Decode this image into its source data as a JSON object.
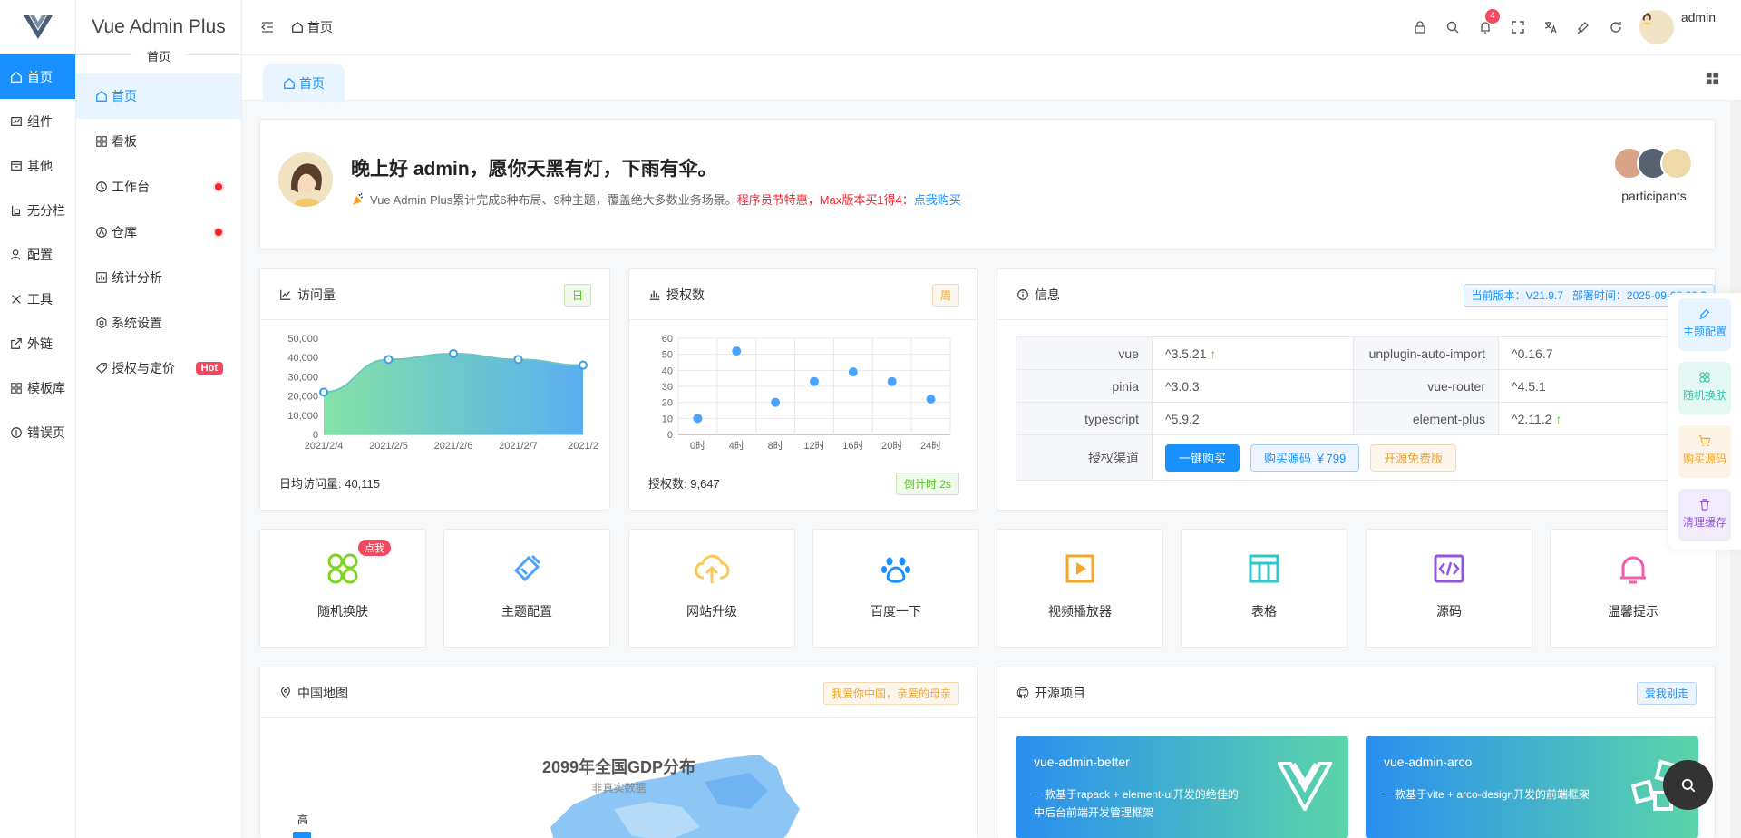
{
  "rail": {
    "items": [
      {
        "label": "首页",
        "icon": "home-icon"
      },
      {
        "label": "组件",
        "icon": "component-icon"
      },
      {
        "label": "其他",
        "icon": "box-icon"
      },
      {
        "label": "无分栏",
        "icon": "layout-icon"
      },
      {
        "label": "配置",
        "icon": "user-config-icon"
      },
      {
        "label": "工具",
        "icon": "tools-icon"
      },
      {
        "label": "外链",
        "icon": "external-link-icon"
      },
      {
        "label": "模板库",
        "icon": "grid-icon"
      },
      {
        "label": "错误页",
        "icon": "error-icon"
      }
    ]
  },
  "menu": {
    "brand": "Vue Admin Plus",
    "group": "首页",
    "items": [
      {
        "label": "首页"
      },
      {
        "label": "看板"
      },
      {
        "label": "工作台"
      },
      {
        "label": "仓库"
      },
      {
        "label": "统计分析"
      },
      {
        "label": "系统设置"
      },
      {
        "label": "授权与定价",
        "badge": "Hot"
      }
    ]
  },
  "header": {
    "breadcrumb": "首页",
    "notify_count": "4",
    "username": "admin"
  },
  "tabs": [
    {
      "label": "首页"
    }
  ],
  "welcome": {
    "title": "晚上好 admin，愿你天黑有灯，下雨有伞。",
    "desc": "Vue Admin Plus累计完成6种布局、9种主题，覆盖绝大多数业务场景。",
    "promo": "程序员节特惠，Max版本买1得4：",
    "link": "点我购买",
    "participants": "participants"
  },
  "visits": {
    "title": "访问量",
    "tag": "日",
    "footer": "日均访问量: 40,115",
    "chart_data": {
      "type": "area",
      "categories": [
        "2021/2/4",
        "2021/2/5",
        "2021/2/6",
        "2021/2/7",
        "2021/2"
      ],
      "values": [
        22000,
        39000,
        42000,
        39000,
        36000
      ],
      "ylim": [
        0,
        50000
      ],
      "yticks": [
        "50,000",
        "40,000",
        "30,000",
        "20,000",
        "10,000",
        "0"
      ],
      "grid": false
    }
  },
  "auth": {
    "title": "授权数",
    "tag": "周",
    "footer": "授权数: 9,647",
    "countdown": "倒计时 2s",
    "chart_data": {
      "type": "scatter",
      "categories": [
        "0时",
        "4时",
        "8时",
        "12时",
        "16时",
        "20时",
        "24时"
      ],
      "values": [
        10,
        52,
        20,
        33,
        39,
        33,
        22
      ],
      "ylim": [
        0,
        60
      ],
      "yticks": [
        "60",
        "50",
        "40",
        "30",
        "20",
        "10",
        "0"
      ],
      "grid": true
    }
  },
  "info": {
    "title": "信息",
    "tag": "当前版本：V21.9.7   部署时间：2025-09-08 20:2",
    "rows": [
      {
        "k1": "vue",
        "v1": "^3.5.21",
        "up1": true,
        "k2": "unplugin-auto-import",
        "v2": "^0.16.7",
        "up2": false
      },
      {
        "k1": "pinia",
        "v1": "^3.0.3",
        "up1": false,
        "k2": "vue-router",
        "v2": "^4.5.1",
        "up2": false
      },
      {
        "k1": "typescript",
        "v1": "^5.9.2",
        "up1": false,
        "k2": "element-plus",
        "v2": "^2.11.2",
        "up2": true
      }
    ],
    "channel_label": "授权渠道",
    "btn_buy": "一键购买",
    "btn_source": "购买源码 ￥799",
    "btn_free": "开源免费版"
  },
  "quick": [
    {
      "label": "随机换肤",
      "icon": "four-circles-icon",
      "color": "#52c41a",
      "flag": "点我"
    },
    {
      "label": "主题配置",
      "icon": "brush-icon",
      "color": "#1890ff"
    },
    {
      "label": "网站升级",
      "icon": "cloud-upload-icon",
      "color": "#fac858"
    },
    {
      "label": "百度一下",
      "icon": "paw-icon",
      "color": "#1890ff"
    },
    {
      "label": "视频播放器",
      "icon": "video-play-icon",
      "color": "#f5a623"
    },
    {
      "label": "表格",
      "icon": "table-icon",
      "color": "#2ec7c9"
    },
    {
      "label": "源码",
      "icon": "code-icon",
      "color": "#9254de"
    },
    {
      "label": "温馨提示",
      "icon": "bell-icon",
      "color": "#f759ab"
    }
  ],
  "map": {
    "title": "中国地图",
    "tag": "我爱你中国，亲爱的母亲",
    "chart_title": "2099年全国GDP分布",
    "chart_subtitle": "非真实数据",
    "legend_high": "高"
  },
  "projects": {
    "title": "开源项目",
    "tag": "爱我别走",
    "items": [
      {
        "name": "vue-admin-better",
        "desc": "一款基于rapack + element-ui开发的绝佳的中后台前端开发管理框架"
      },
      {
        "name": "vue-admin-arco",
        "desc": "一款基于vite + arco-design开发的前端框架"
      }
    ]
  },
  "float_tools": [
    {
      "label": "主题配置",
      "color": "#1890ff",
      "bg": "#e8f4ff"
    },
    {
      "label": "随机换肤",
      "color": "#2ec7a9",
      "bg": "#e6f8f3"
    },
    {
      "label": "购买源码",
      "color": "#f5a623",
      "bg": "#fdf3e6"
    },
    {
      "label": "清理缓存",
      "color": "#9254de",
      "bg": "#f3ecfd"
    }
  ]
}
